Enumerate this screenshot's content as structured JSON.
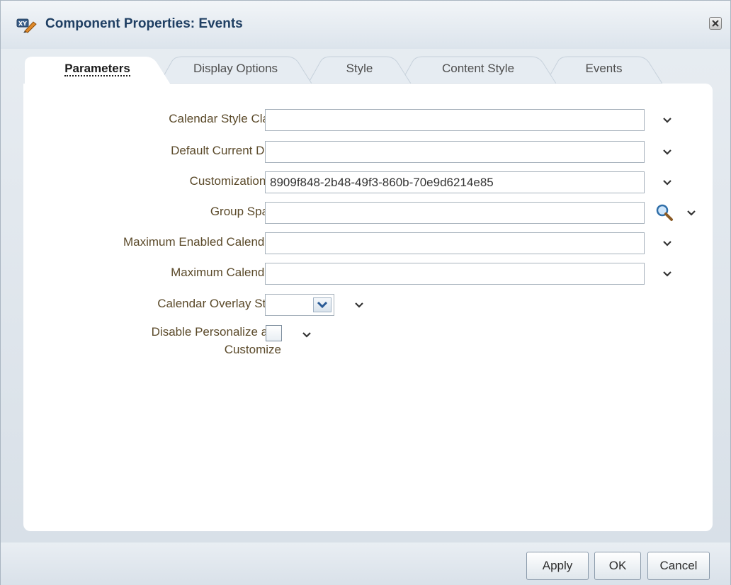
{
  "dialog": {
    "title": "Component Properties: Events"
  },
  "tabs": [
    {
      "label": "Parameters",
      "active": true
    },
    {
      "label": "Display Options",
      "active": false
    },
    {
      "label": "Style",
      "active": false
    },
    {
      "label": "Content Style",
      "active": false
    },
    {
      "label": "Events",
      "active": false
    }
  ],
  "fields": {
    "calendar_style_class": {
      "label": "Calendar Style Class",
      "value": ""
    },
    "default_current_date": {
      "label": "Default Current Date",
      "value": ""
    },
    "customization_id": {
      "label": "Customization ID",
      "value": "8909f848-2b48-49f3-860b-70e9d6214e85"
    },
    "group_space": {
      "label": "Group Space",
      "value": ""
    },
    "maximum_enabled_calendars": {
      "label": "Maximum Enabled Calendars",
      "value": ""
    },
    "maximum_calendars": {
      "label": "Maximum Calendars",
      "value": ""
    },
    "calendar_overlay_style": {
      "label": "Calendar Overlay Style",
      "value": ""
    },
    "disable_personalize": {
      "label_line1": "Disable Personalize and",
      "label_line2": "Customize",
      "checked": false
    }
  },
  "buttons": {
    "apply": "Apply",
    "ok": "OK",
    "cancel": "Cancel"
  },
  "icons": {
    "title": "component-properties-icon",
    "close": "close-icon",
    "search": "search-icon",
    "chevron": "chevron-down-icon"
  },
  "colors": {
    "title_text": "#1f3f63",
    "label_text": "#5b4a2a",
    "panel_bg": "#ffffff"
  }
}
